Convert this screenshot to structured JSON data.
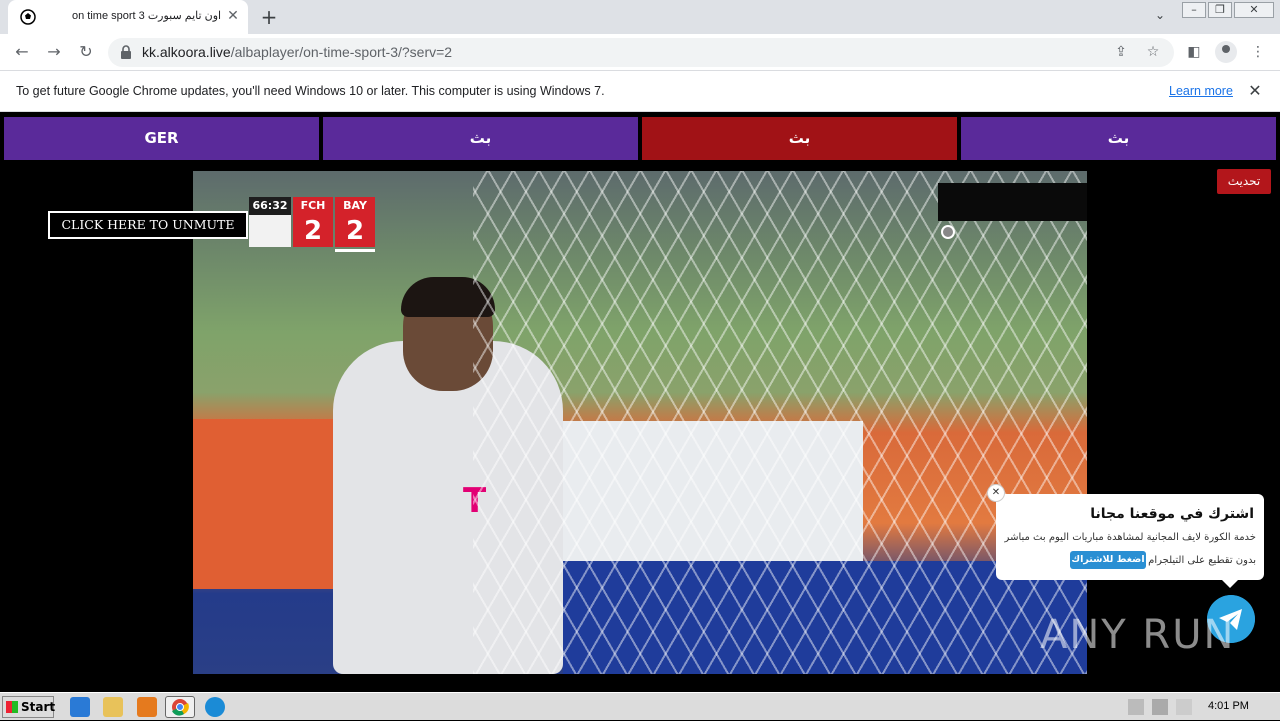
{
  "browser": {
    "tab": {
      "title": "on time sport 3 اون تايم سبورت",
      "favicon": "soccer-ball-icon"
    },
    "new_tab": "+",
    "url": {
      "host": "kk.alkoora.live",
      "path": "/albaplayer/on-time-sport-3/?serv=2"
    },
    "infobar": {
      "message": "To get future Google Chrome updates, you'll need Windows 10 or later. This computer is using Windows 7.",
      "link": "Learn more"
    }
  },
  "page": {
    "servers": [
      {
        "label": "GER",
        "active": false
      },
      {
        "label": "بث",
        "active": false
      },
      {
        "label": "بث",
        "active": true
      },
      {
        "label": "بث",
        "active": false
      }
    ],
    "refresh_label": "تحديث",
    "unmute_label": "CLICK HERE TO UNMUTE",
    "scorebug": {
      "time": "66:32",
      "home": {
        "code": "FCH",
        "score": "2"
      },
      "away": {
        "code": "BAY",
        "score": "2"
      }
    },
    "popup": {
      "title": "اشترك في موقعنا مجانا",
      "line1": "خدمة الكورة لايف المجانية لمشاهدة مباريات اليوم بث مباشر",
      "line2": "بدون تقطيع على التيلجرام",
      "cta": "اضغط للاشتراك"
    },
    "watermark": "ANY RUN"
  },
  "taskbar": {
    "start_label": "Start",
    "clock": "4:01 PM"
  },
  "colors": {
    "server_purple": "#5a2a9a",
    "server_active_red": "#a11216",
    "refresh_red": "#b3161b",
    "telegram_blue": "#2aa3e0"
  }
}
